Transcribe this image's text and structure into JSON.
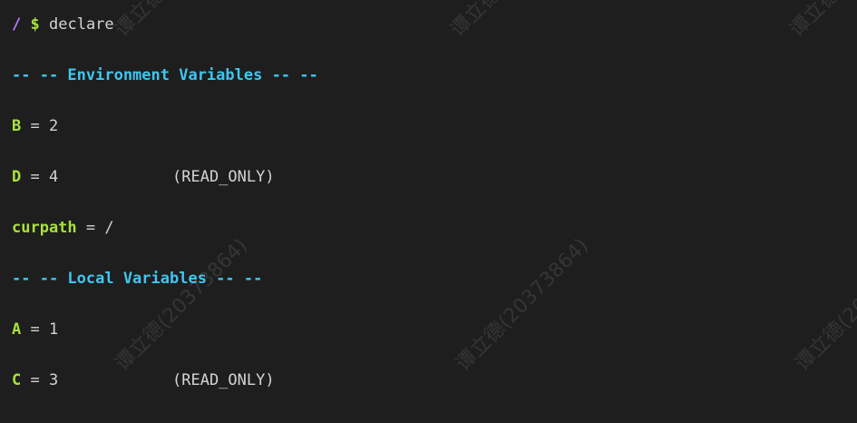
{
  "prompt": {
    "path": "/",
    "symbol": "$",
    "command": "declare"
  },
  "env_section": {
    "header": "-- -- Environment Variables -- --",
    "vars": [
      {
        "name": "B",
        "eq": " = ",
        "value": "2",
        "flag": ""
      },
      {
        "name": "D",
        "eq": " = ",
        "value": "4",
        "flag": "(READ_ONLY)"
      },
      {
        "name": "curpath",
        "eq": " = ",
        "value": "/",
        "flag": ""
      }
    ]
  },
  "local_section": {
    "header": "-- -- Local Variables -- --",
    "vars": [
      {
        "name": "A",
        "eq": " = ",
        "value": "1",
        "flag": ""
      },
      {
        "name": "C",
        "eq": " = ",
        "value": "3",
        "flag": "(READ_ONLY)"
      }
    ]
  },
  "watermark": {
    "text": "谭立德(20373864)"
  },
  "colors": {
    "background": "#1e1e1e",
    "path": "#b57cff",
    "prompt_symbol": "#a8e23a",
    "header": "#3fc6f0",
    "var_name": "#a8e23a",
    "text": "#d4d4d4"
  }
}
